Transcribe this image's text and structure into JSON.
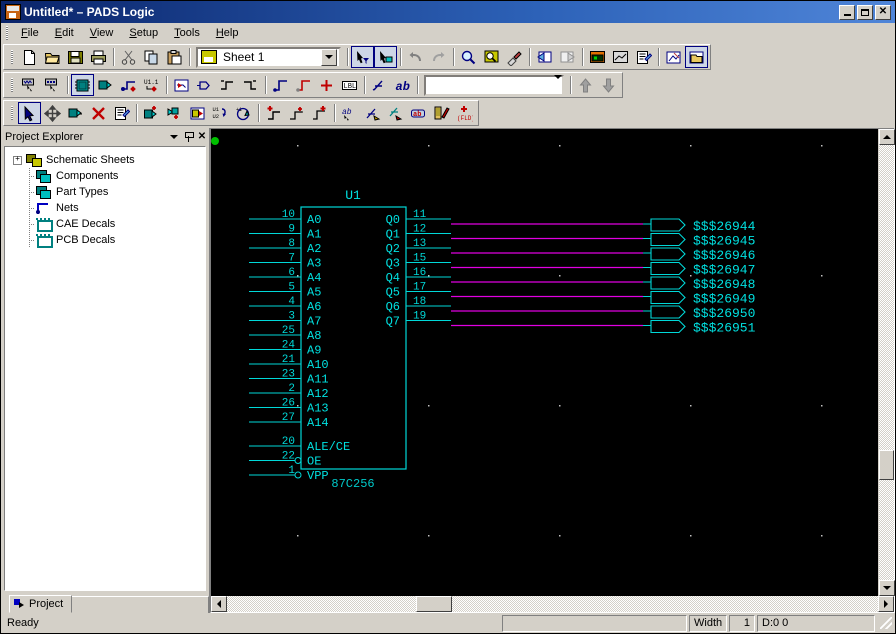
{
  "window": {
    "title": "Untitled* – PADS Logic",
    "icon": "pads-logo-icon",
    "controls": {
      "minimize": "minimize-button",
      "maximize": "maximize-button",
      "close": "close-button"
    }
  },
  "menu": {
    "items": [
      {
        "label": "File",
        "mnemonic": "F"
      },
      {
        "label": "Edit",
        "mnemonic": "E"
      },
      {
        "label": "View",
        "mnemonic": "V"
      },
      {
        "label": "Setup",
        "mnemonic": "S"
      },
      {
        "label": "Tools",
        "mnemonic": "T"
      },
      {
        "label": "Help",
        "mnemonic": "H"
      }
    ]
  },
  "toolbar": {
    "sheet_combo": {
      "value": "Sheet 1",
      "icon": "sheet-icon"
    },
    "field_combo": {
      "value": "",
      "placeholder": ""
    },
    "row1": [
      "new-icon",
      "open-icon",
      "save-icon",
      "print-icon",
      "cut-icon",
      "copy-icon",
      "paste-icon",
      "select-filter-icon",
      "select-net-icon",
      "undo-icon",
      "redo-icon",
      "zoom-icon",
      "zoom-area-icon",
      "redraw-icon",
      "back-icon",
      "forward-icon",
      "pads-layout-icon",
      "pads-router-icon",
      "properties-icon",
      "ole-icon",
      "project-explorer-icon"
    ],
    "row2": [
      "select-net-tool-icon",
      "select-connection-icon",
      "add-part-icon",
      "add-connection-icon",
      "add-bus-icon",
      "rename-part-icon",
      "add-off-page-icon",
      "add-terminal-icon",
      "add-source-icon",
      "add-sink-icon",
      "add-net-flag-icon",
      "add-bus-flag-icon",
      "add-junction-icon",
      "add-label-icon",
      "add-field-icon",
      "add-text-icon"
    ],
    "row3": [
      "pointer-icon",
      "move-icon",
      "copy-entity-icon",
      "delete-icon",
      "query-icon",
      "add-part-2-icon",
      "add-connection-2-icon",
      "add-sheet-icon",
      "swap-refdes-icon",
      "swap-gates-icon",
      "add-net-flag-2-icon",
      "add-off-page-2-icon",
      "add-source-2-icon",
      "edit-attr-icon",
      "edit-net-icon",
      "edit-bus-icon",
      "edit-label-icon",
      "edit-text-icon",
      "add-field-2-icon"
    ],
    "nav": {
      "up": "move-up-icon",
      "down": "move-down-icon"
    }
  },
  "project_explorer": {
    "title": "Project Explorer",
    "menu_icon": "chevron-down-icon",
    "pin_icon": "pin-icon",
    "close_icon": "close-icon",
    "tree": [
      {
        "label": "Schematic Sheets",
        "icon": "schematic-sheets-icon",
        "expandable": true,
        "expander": "+"
      },
      {
        "label": "Components",
        "icon": "components-icon",
        "expandable": false,
        "expander": ""
      },
      {
        "label": "Part Types",
        "icon": "part-types-icon",
        "expandable": false,
        "expander": ""
      },
      {
        "label": "Nets",
        "icon": "nets-icon",
        "expandable": false,
        "expander": ""
      },
      {
        "label": "CAE Decals",
        "icon": "cae-decals-icon",
        "expandable": false,
        "expander": ""
      },
      {
        "label": "PCB Decals",
        "icon": "pcb-decals-icon",
        "expandable": false,
        "expander": ""
      }
    ],
    "tab": {
      "label": "Project",
      "icon": "project-tab-icon"
    }
  },
  "schematic": {
    "background": "#000000",
    "component_color": "#00d8d8",
    "label_color": "#00e0e0",
    "pin_number_color": "#00d8d8",
    "wire_color": "#e000e0",
    "origin_color": "#00c000",
    "grid_dot_color": "#c0c0c0",
    "reference_designator": "U1",
    "part_type": "87C256",
    "left_pins": [
      {
        "number": "10",
        "name": "A0"
      },
      {
        "number": "9",
        "name": "A1"
      },
      {
        "number": "8",
        "name": "A2"
      },
      {
        "number": "7",
        "name": "A3"
      },
      {
        "number": "6",
        "name": "A4"
      },
      {
        "number": "5",
        "name": "A5"
      },
      {
        "number": "4",
        "name": "A6"
      },
      {
        "number": "3",
        "name": "A7"
      },
      {
        "number": "25",
        "name": "A8"
      },
      {
        "number": "24",
        "name": "A9"
      },
      {
        "number": "21",
        "name": "A10"
      },
      {
        "number": "23",
        "name": "A11"
      },
      {
        "number": "2",
        "name": "A12"
      },
      {
        "number": "26",
        "name": "A13"
      },
      {
        "number": "27",
        "name": "A14"
      }
    ],
    "control_pins": [
      {
        "number": "20",
        "name": "ALE/CE",
        "inverted": false
      },
      {
        "number": "22",
        "name": "OE",
        "inverted": true
      },
      {
        "number": "1",
        "name": "VPP",
        "inverted": true
      }
    ],
    "right_pins": [
      {
        "number": "11",
        "name": "Q0",
        "net": "$$$26944"
      },
      {
        "number": "12",
        "name": "Q1",
        "net": "$$$26945"
      },
      {
        "number": "13",
        "name": "Q2",
        "net": "$$$26946"
      },
      {
        "number": "15",
        "name": "Q3",
        "net": "$$$26947"
      },
      {
        "number": "16",
        "name": "Q4",
        "net": "$$$26948"
      },
      {
        "number": "17",
        "name": "Q5",
        "net": "$$$26949"
      },
      {
        "number": "18",
        "name": "Q6",
        "net": "$$$26950"
      },
      {
        "number": "19",
        "name": "Q7",
        "net": "$$$26951"
      }
    ]
  },
  "statusbar": {
    "message": "Ready",
    "progress": "",
    "width_label": "Width",
    "width_value": "1",
    "coordinates": "D:0 0"
  }
}
